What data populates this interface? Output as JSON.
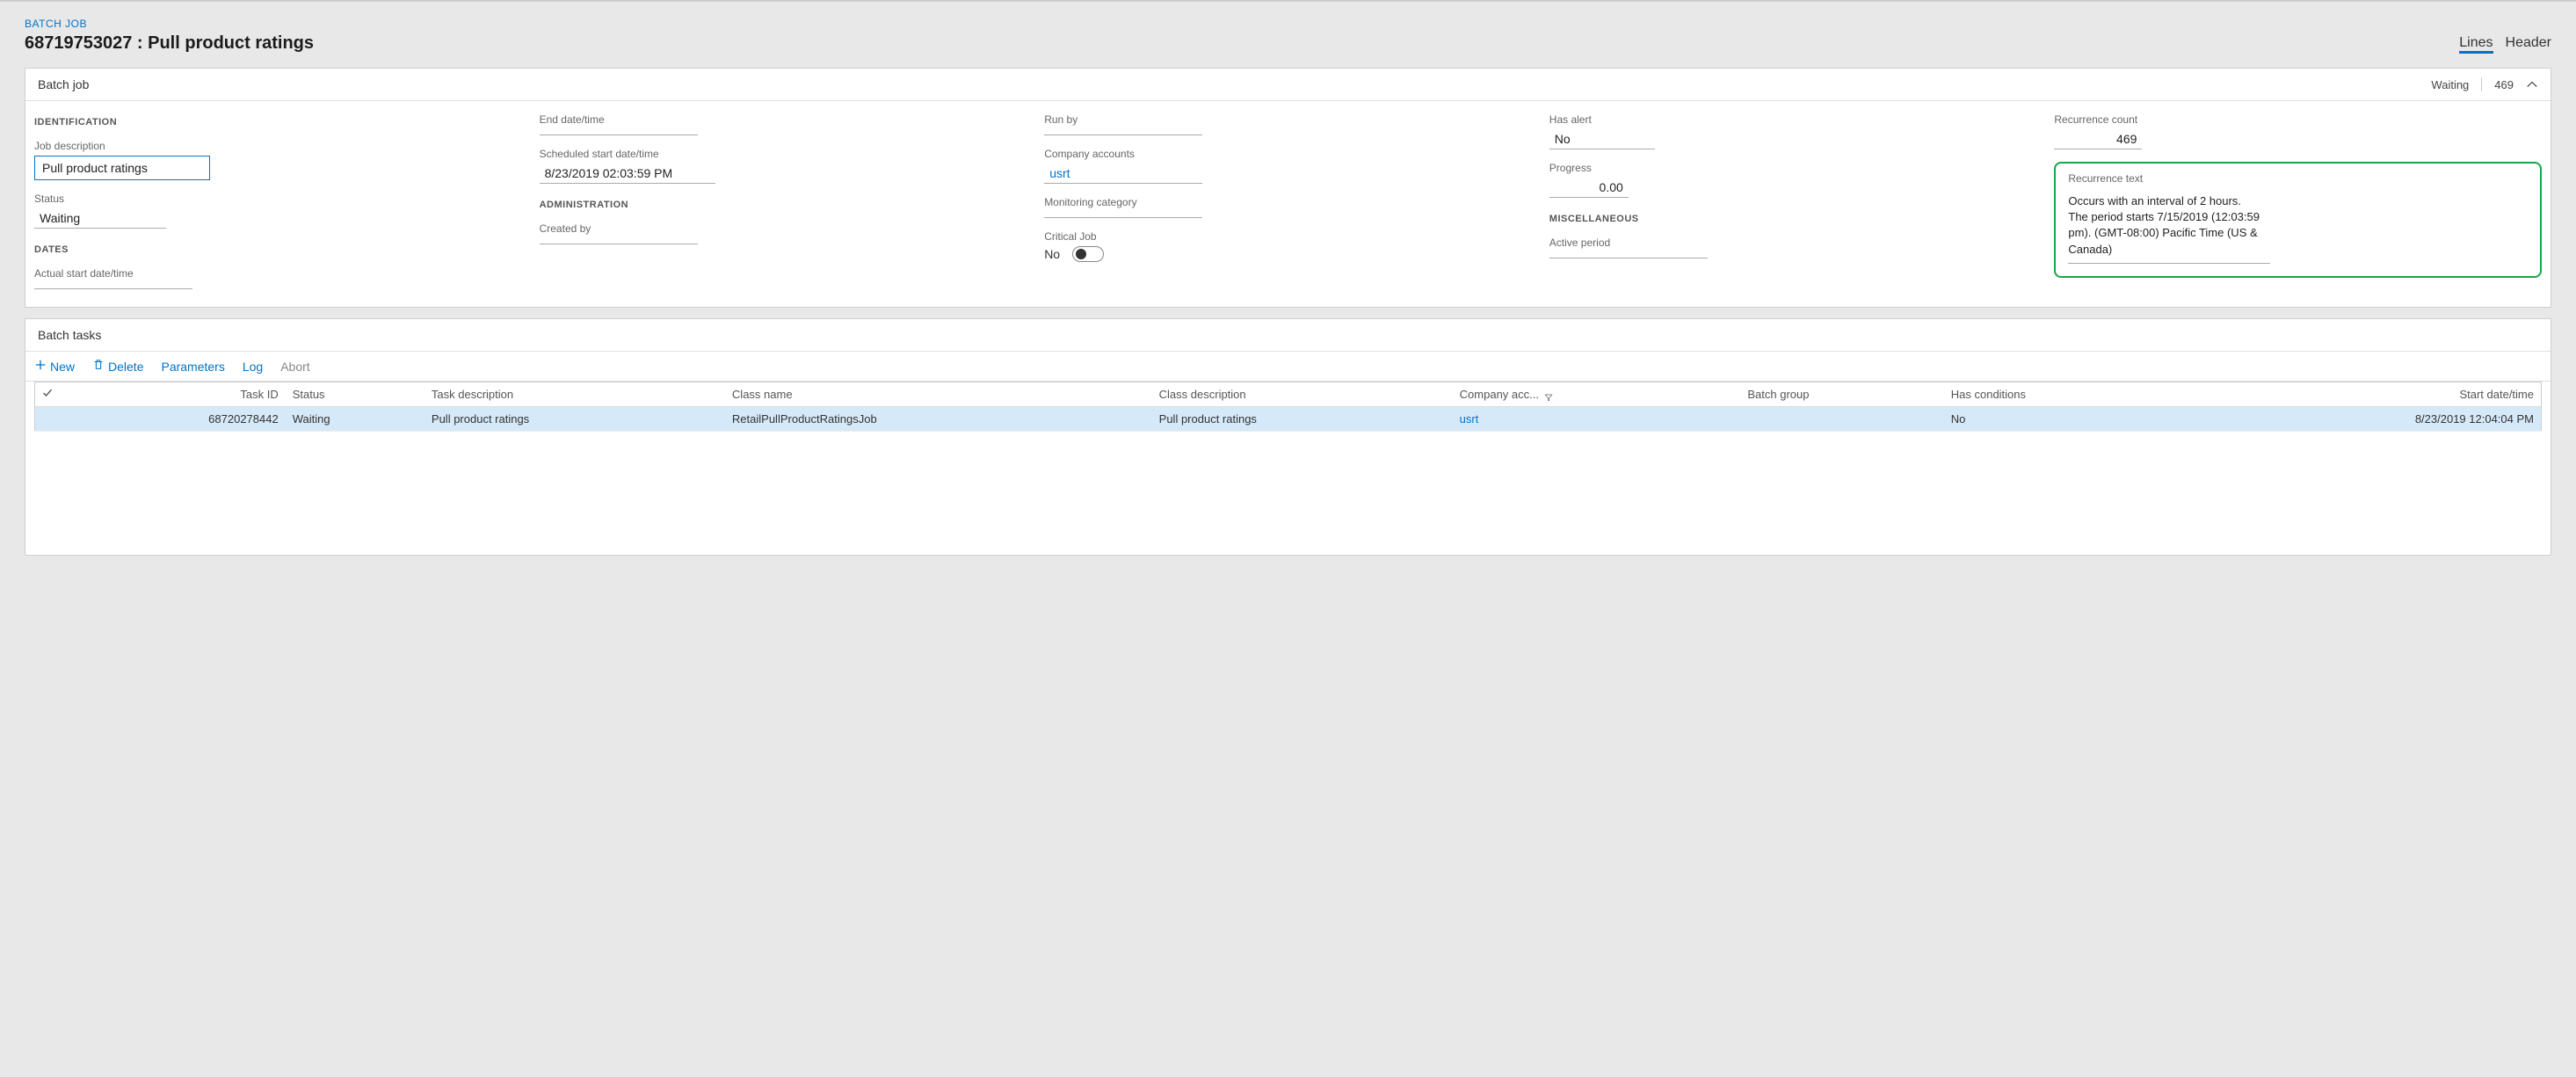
{
  "breadcrumb": "BATCH JOB",
  "page_title": "68719753027 : Pull product ratings",
  "view_switch": {
    "lines": "Lines",
    "header": "Header",
    "active": "lines"
  },
  "batch_job_panel": {
    "title": "Batch job",
    "status_summary": "Waiting",
    "count_summary": "469",
    "identification_heading": "IDENTIFICATION",
    "job_description_label": "Job description",
    "job_description_value": "Pull product ratings",
    "status_label": "Status",
    "status_value": "Waiting",
    "dates_heading": "DATES",
    "actual_start_label": "Actual start date/time",
    "actual_start_value": "",
    "end_date_label": "End date/time",
    "end_date_value": "",
    "scheduled_start_label": "Scheduled start date/time",
    "scheduled_start_value": "8/23/2019 02:03:59 PM",
    "administration_heading": "ADMINISTRATION",
    "created_by_label": "Created by",
    "created_by_value": "",
    "run_by_label": "Run by",
    "run_by_value": "",
    "company_accounts_label": "Company accounts",
    "company_accounts_value": "usrt",
    "monitoring_category_label": "Monitoring category",
    "monitoring_category_value": "",
    "critical_job_label": "Critical Job",
    "critical_job_value": "No",
    "has_alert_label": "Has alert",
    "has_alert_value": "No",
    "progress_label": "Progress",
    "progress_value": "0.00",
    "misc_heading": "MISCELLANEOUS",
    "active_period_label": "Active period",
    "active_period_value": "",
    "recurrence_count_label": "Recurrence count",
    "recurrence_count_value": "469",
    "recurrence_text_label": "Recurrence text",
    "recurrence_text_value": "Occurs with an interval of 2 hours. The period starts 7/15/2019 (12:03:59 pm). (GMT-08:00) Pacific Time (US & Canada)"
  },
  "batch_tasks_panel": {
    "title": "Batch tasks",
    "toolbar": {
      "new": "New",
      "delete": "Delete",
      "parameters": "Parameters",
      "log": "Log",
      "abort": "Abort"
    },
    "columns": {
      "task_id": "Task ID",
      "status": "Status",
      "task_description": "Task description",
      "class_name": "Class name",
      "class_description": "Class description",
      "company_accounts": "Company acc...",
      "batch_group": "Batch group",
      "has_conditions": "Has conditions",
      "start_date": "Start date/time"
    },
    "rows": [
      {
        "task_id": "68720278442",
        "status": "Waiting",
        "task_description": "Pull product ratings",
        "class_name": "RetailPullProductRatingsJob",
        "class_description": "Pull product ratings",
        "company_accounts": "usrt",
        "batch_group": "",
        "has_conditions": "No",
        "start_date": "8/23/2019 12:04:04 PM"
      }
    ]
  }
}
